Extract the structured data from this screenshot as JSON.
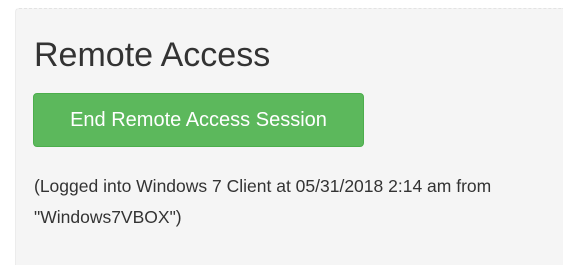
{
  "remote_access": {
    "title": "Remote Access",
    "end_button_label": "End Remote Access Session",
    "session_info": "(Logged into Windows 7 Client at 05/31/2018 2:14 am from \"Windows7VBOX\")"
  },
  "colors": {
    "button_bg": "#5cb85c",
    "button_border": "#4cae4c",
    "panel_bg": "#f5f5f5",
    "text": "#333333"
  }
}
